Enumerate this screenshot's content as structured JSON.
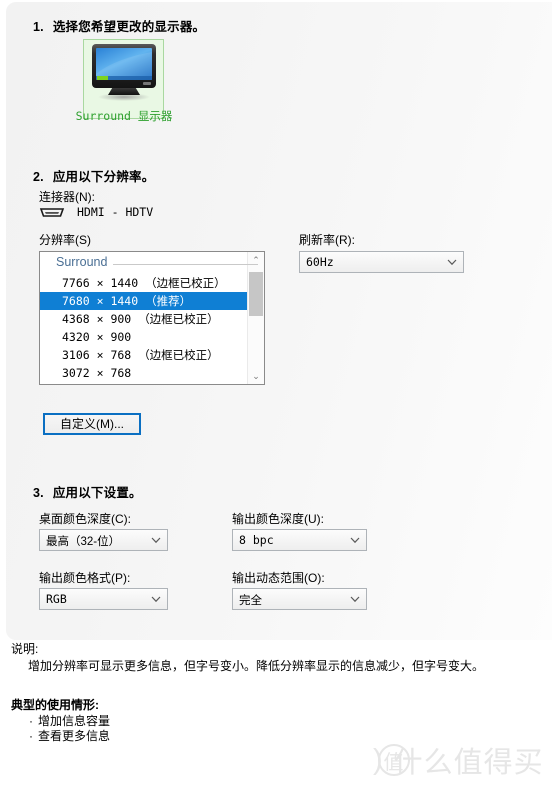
{
  "steps": {
    "one": {
      "num": "1.",
      "title": "选择您希望更改的显示器。"
    },
    "two": {
      "num": "2.",
      "title": "应用以下分辨率。"
    },
    "three": {
      "num": "3.",
      "title": "应用以下设置。"
    }
  },
  "monitor": {
    "label": "Surround 显示器",
    "icon": "monitor-icon"
  },
  "connector": {
    "label": "连接器(N):",
    "icon": "hdmi-connector-icon",
    "value": "HDMI - HDTV"
  },
  "resolution": {
    "label": "分辨率(S)",
    "group_header": "Surround",
    "items": [
      {
        "res": "7766 × 1440",
        "note": "（边框已校正）",
        "selected": false
      },
      {
        "res": "7680 × 1440",
        "note": "（推荐）",
        "selected": true
      },
      {
        "res": "4368 × 900",
        "note": "（边框已校正）",
        "selected": false
      },
      {
        "res": "4320 × 900",
        "note": "",
        "selected": false
      },
      {
        "res": "3106 × 768",
        "note": "（边框已校正）",
        "selected": false
      },
      {
        "res": "3072 × 768",
        "note": "",
        "selected": false
      }
    ],
    "scroll_up_glyph": "⌃",
    "scroll_down_glyph": "⌄"
  },
  "refresh": {
    "label": "刷新率(R):",
    "value": "60Hz"
  },
  "custom_button": {
    "label": "自定义(M)..."
  },
  "settings": {
    "desktop_depth": {
      "label": "桌面颜色深度(C):",
      "value": "最高（32-位）"
    },
    "output_depth": {
      "label": "输出颜色深度(U):",
      "value": "8 bpc"
    },
    "output_format": {
      "label": "输出颜色格式(P):",
      "value": "RGB"
    },
    "output_range": {
      "label": "输出动态范围(O):",
      "value": "完全"
    }
  },
  "description": {
    "heading": "说明:",
    "body": "增加分辨率可显示更多信息，但字号变小。降低分辨率显示的信息减少，但字号变大。",
    "usage_heading": "典型的使用情形:",
    "bullet_glyph": "·",
    "bullets": [
      "增加信息容量",
      "查看更多信息"
    ]
  },
  "watermark": {
    "badge": "值",
    "paren": ")",
    "text": "什么值得买"
  },
  "colors": {
    "selection_blue": "#0f7fd4",
    "focus_border": "#0a6fc2",
    "monitor_green": "#2ea02e",
    "group_header": "#4a6f94"
  }
}
